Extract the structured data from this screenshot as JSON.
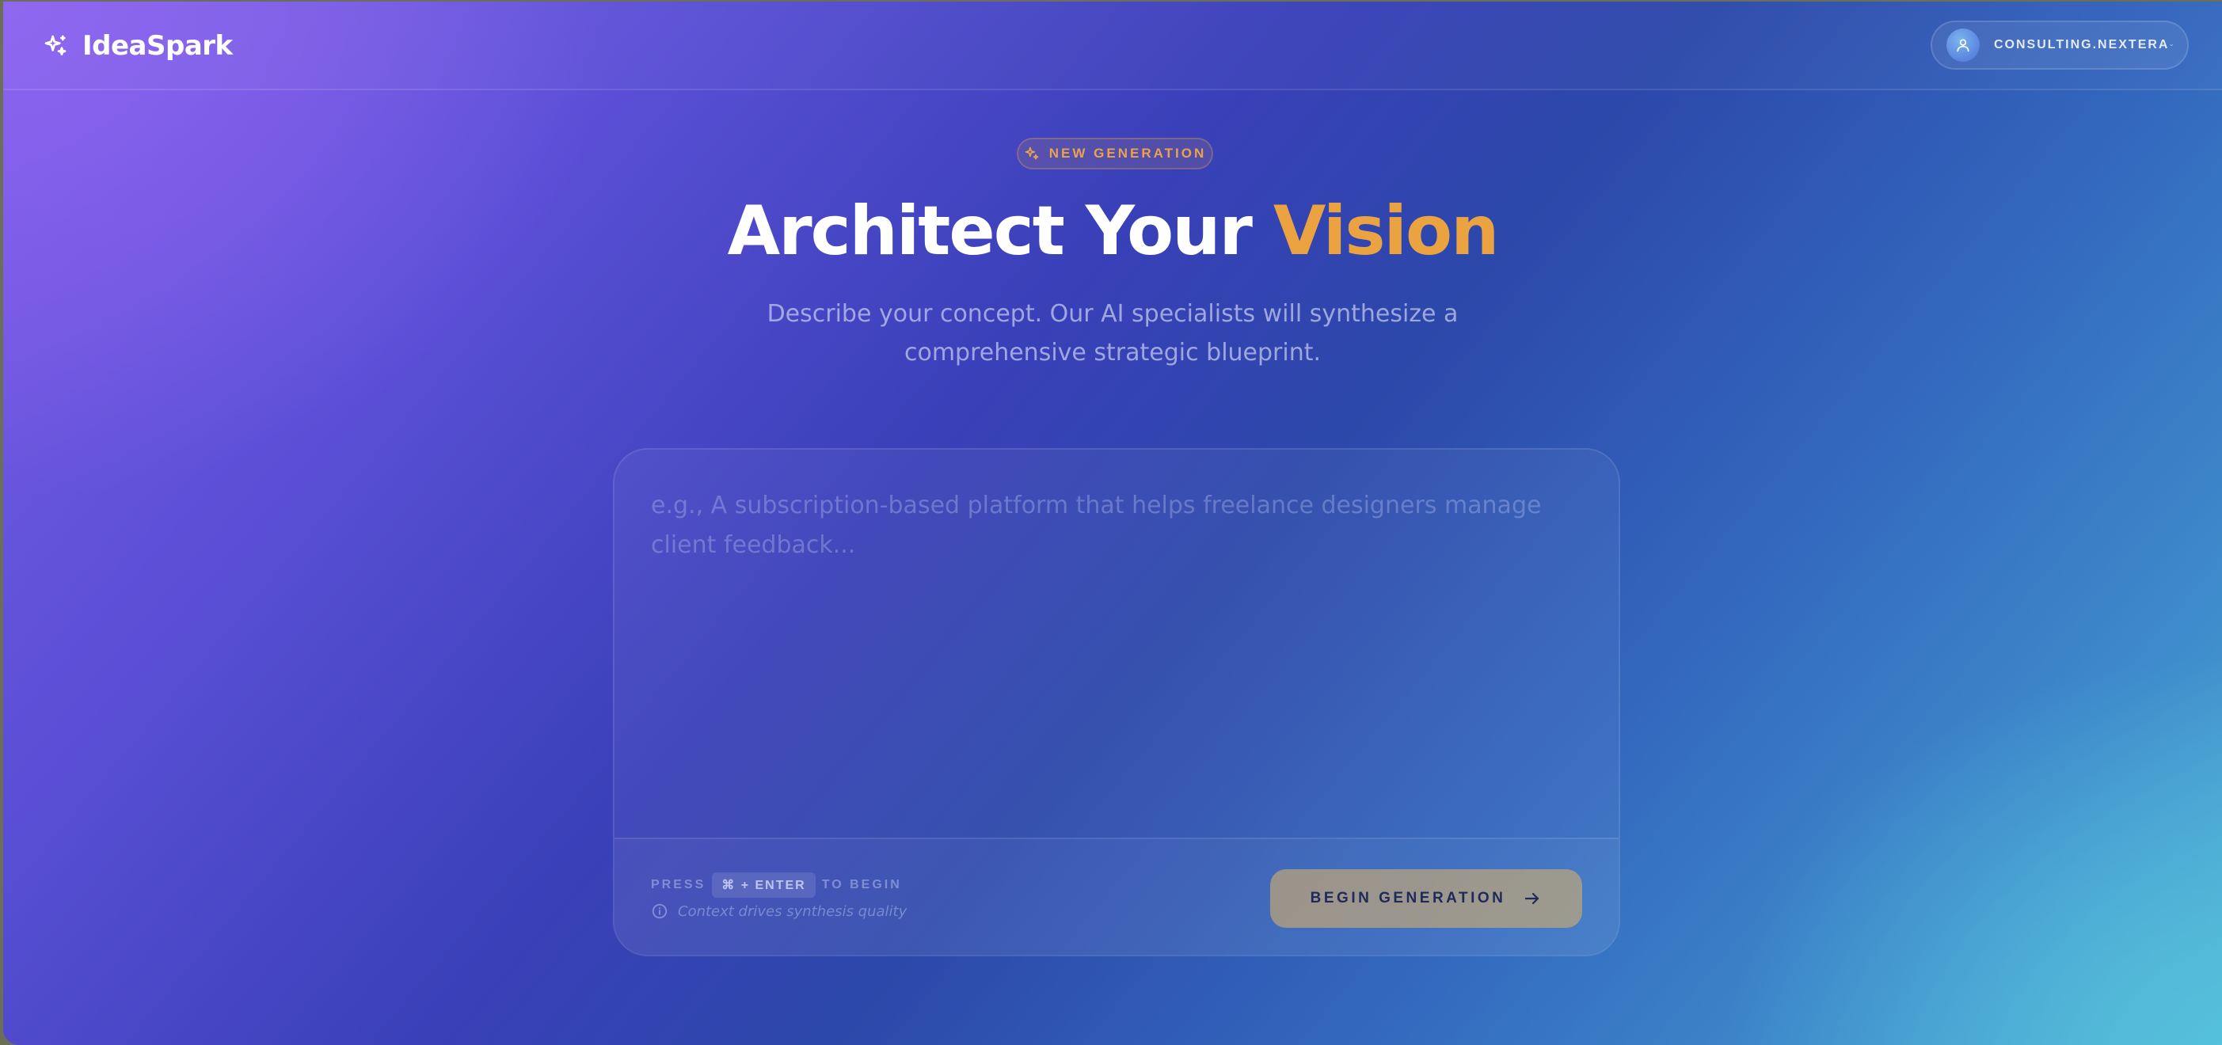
{
  "app": {
    "name": "IdeaSpark"
  },
  "account": {
    "name": "CONSULTING.NEXTERA"
  },
  "hero": {
    "badge": "NEW GENERATION",
    "title_main": "Architect Your ",
    "title_accent": "Vision",
    "subtitle": "Describe your concept. Our AI specialists will synthesize a comprehensive strategic blueprint."
  },
  "prompt": {
    "value": "",
    "placeholder": "e.g., A subscription-based platform that helps freelance designers manage client feedback...",
    "hint_press": "PRESS",
    "hint_keys": "⌘ + ENTER",
    "hint_to_begin": "TO BEGIN",
    "note": "Context drives synthesis quality",
    "submit_label": "BEGIN GENERATION"
  },
  "colors": {
    "accent": "#eba240",
    "button": "#d2af6e",
    "button_text": "#1f2a5a"
  },
  "icons": {
    "brand": "sparkles-icon",
    "badge": "sparkles-icon",
    "avatar": "user-icon",
    "account_menu": "chevron-down-icon",
    "note": "info-icon",
    "submit": "arrow-right-icon"
  }
}
